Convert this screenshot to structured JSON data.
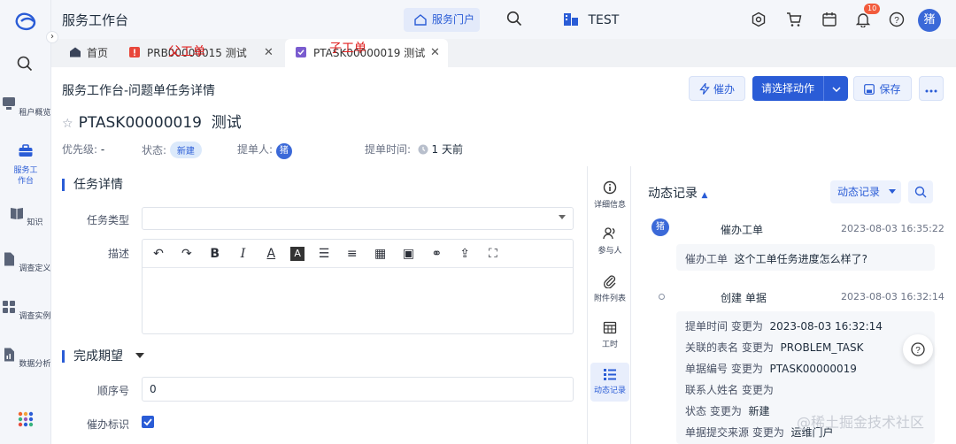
{
  "rail": {
    "items": [
      {
        "label": "租户概览"
      },
      {
        "label": "服务工作台"
      },
      {
        "label": "知识"
      },
      {
        "label": "调查定义"
      },
      {
        "label": "调查实例"
      },
      {
        "label": "数据分析"
      }
    ]
  },
  "topbar": {
    "title": "服务工作台",
    "portal": "服务门户",
    "tenant": "TEST",
    "notif_count": "10",
    "avatar": "猪"
  },
  "tabs": [
    {
      "label": "首页"
    },
    {
      "label": "PRB00000015 测试"
    },
    {
      "label": "PTASK00000019 测试"
    }
  ],
  "annotations": {
    "parent": "父工单",
    "child": "子工单"
  },
  "page": {
    "heading": "服务工作台-问题单任务详情",
    "urge": "催办",
    "action": "请选择动作",
    "save": "保存",
    "ticket_no": "PTASK00000019",
    "ticket_name": "测试",
    "priority_label": "优先级:",
    "priority_value": "-",
    "status_label": "状态:",
    "status_value": "新建",
    "submitter_label": "提单人:",
    "submitter_avatar": "猪",
    "submit_time_label": "提单时间:",
    "submit_time_value": "1 天前"
  },
  "form": {
    "task_section": "任务详情",
    "task_type_label": "任务类型",
    "desc_label": "描述",
    "expect_section": "完成期望",
    "order_label": "顺序号",
    "order_value": "0",
    "urge_flag_label": "催办标识"
  },
  "side_tabs": [
    {
      "label": "详细信息"
    },
    {
      "label": "参与人"
    },
    {
      "label": "附件列表"
    },
    {
      "label": "工时"
    },
    {
      "label": "动态记录"
    }
  ],
  "activity": {
    "title": "动态记录",
    "filter": "动态记录",
    "entry1": {
      "avatar": "猪",
      "action": "催办工单",
      "time": "2023-08-03 16:35:22",
      "body_key": "催办工单",
      "body_value": "这个工单任务进度怎么样了?"
    },
    "entry2": {
      "action": "创建 单据",
      "time": "2023-08-03 16:32:14",
      "rows": [
        {
          "k": "提单时间 变更为",
          "v": "2023-08-03 16:32:14"
        },
        {
          "k": "关联的表名 变更为",
          "v": "PROBLEM_TASK"
        },
        {
          "k": "单据编号 变更为",
          "v": "PTASK00000019"
        },
        {
          "k": "联系人姓名 变更为",
          "v": ""
        },
        {
          "k": "状态 变更为",
          "v": "新建"
        },
        {
          "k": "单据提交来源 变更为",
          "v": "运维门户"
        }
      ]
    }
  },
  "watermark": "@稀土掘金技术社区",
  "colors": {
    "primary": "#2a5cd6",
    "badge": "#f25b3c"
  }
}
